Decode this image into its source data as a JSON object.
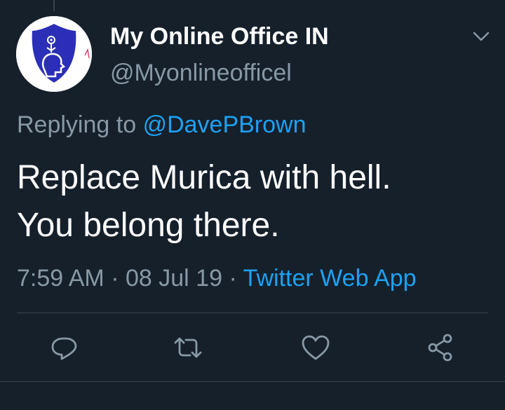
{
  "tweet": {
    "display_name": "My Online Office IN",
    "handle": "@Myonlineofficel",
    "replying_prefix": "Replying to",
    "replying_to": "@DavePBrown",
    "text_line_1": "Replace Murica with hell.",
    "text_line_2": "You belong there.",
    "time": "7:59 AM",
    "date": "08 Jul 19",
    "separator": "·",
    "source": "Twitter Web App"
  },
  "icons": {
    "avatar": "avatar-logo-icon",
    "menu": "chevron-down-icon",
    "actions": [
      "reply-icon",
      "retweet-icon",
      "like-icon",
      "share-icon"
    ]
  },
  "colors": {
    "background": "#15202b",
    "text": "#ffffff",
    "secondary_text": "#8899a6",
    "link": "#1da1f2",
    "divider": "#38444d",
    "avatar_badge": "#2b2fb8"
  }
}
